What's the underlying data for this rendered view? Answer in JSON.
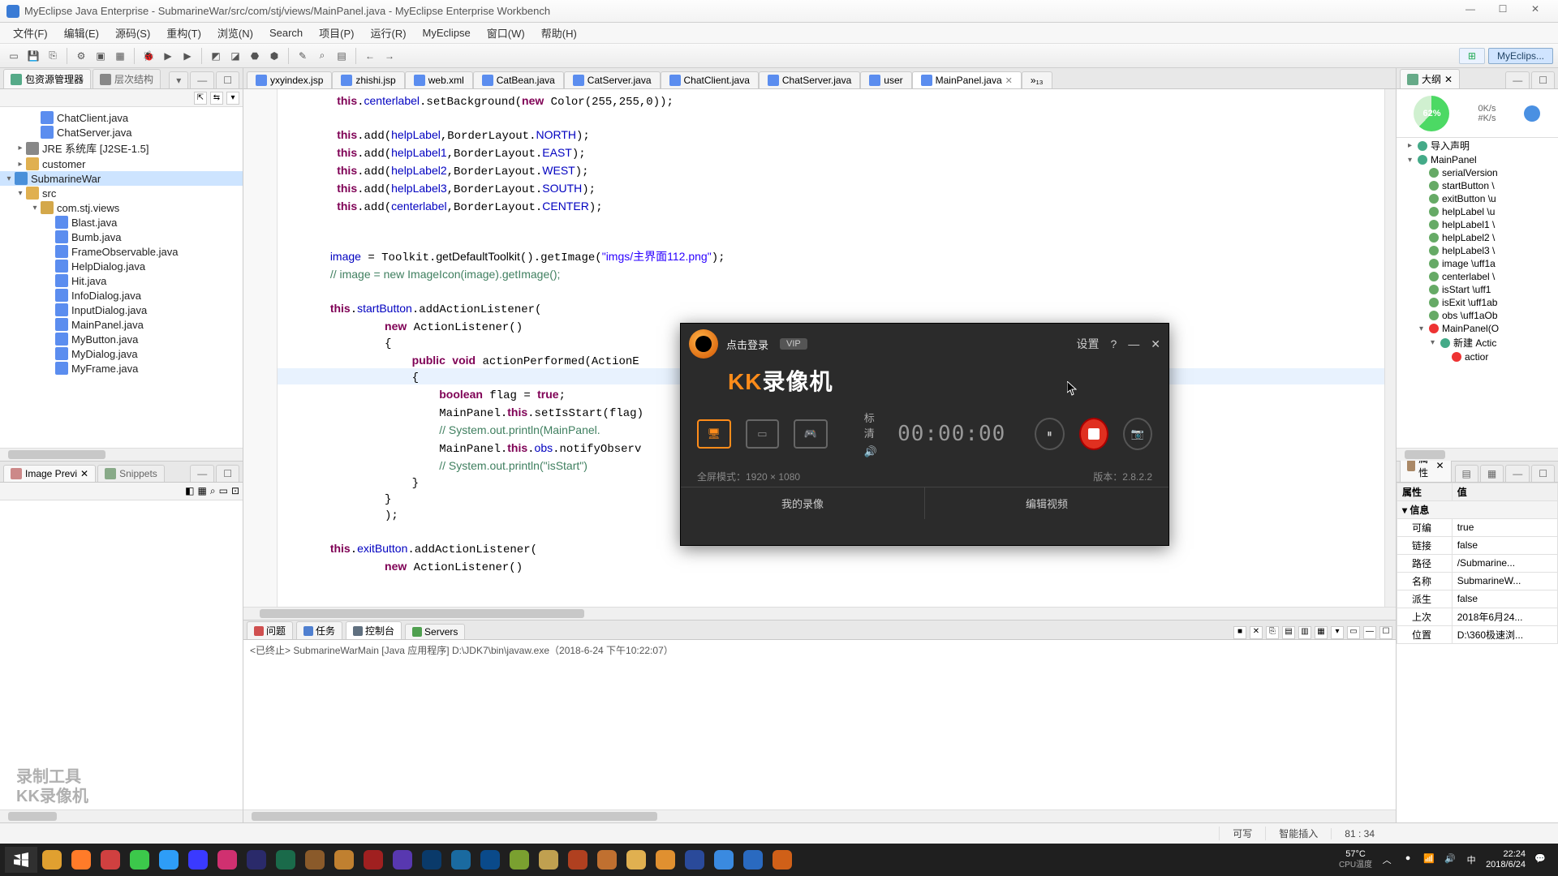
{
  "title": "MyEclipse Java Enterprise  -  SubmarineWar/src/com/stj/views/MainPanel.java  -  MyEclipse Enterprise Workbench",
  "menu": [
    "文件(F)",
    "编辑(E)",
    "源码(S)",
    "重构(T)",
    "浏览(N)",
    "Search",
    "项目(P)",
    "运行(R)",
    "MyEclipse",
    "窗口(W)",
    "帮助(H)"
  ],
  "perspective_active": "MyEclips...",
  "left": {
    "tabs": [
      "包资源管理器",
      "层次结构"
    ],
    "tree": [
      {
        "d": 2,
        "icon": "java",
        "label": "ChatClient.java"
      },
      {
        "d": 2,
        "icon": "java",
        "label": "ChatServer.java"
      },
      {
        "d": 1,
        "icon": "lib",
        "label": "JRE 系统库 [J2SE-1.5]",
        "arrow": "▸"
      },
      {
        "d": 1,
        "icon": "fold",
        "label": "customer",
        "arrow": "▸"
      },
      {
        "d": 0,
        "icon": "proj",
        "label": "SubmarineWar",
        "arrow": "▾",
        "sel": true
      },
      {
        "d": 1,
        "icon": "fold",
        "label": "src",
        "arrow": "▾"
      },
      {
        "d": 2,
        "icon": "pkg",
        "label": "com.stj.views",
        "arrow": "▾"
      },
      {
        "d": 3,
        "icon": "java",
        "label": "Blast.java"
      },
      {
        "d": 3,
        "icon": "java",
        "label": "Bumb.java"
      },
      {
        "d": 3,
        "icon": "java",
        "label": "FrameObservable.java"
      },
      {
        "d": 3,
        "icon": "java",
        "label": "HelpDialog.java"
      },
      {
        "d": 3,
        "icon": "java",
        "label": "Hit.java"
      },
      {
        "d": 3,
        "icon": "java",
        "label": "InfoDialog.java"
      },
      {
        "d": 3,
        "icon": "java",
        "label": "InputDialog.java"
      },
      {
        "d": 3,
        "icon": "java",
        "label": "MainPanel.java"
      },
      {
        "d": 3,
        "icon": "java",
        "label": "MyButton.java"
      },
      {
        "d": 3,
        "icon": "java",
        "label": "MyDialog.java"
      },
      {
        "d": 3,
        "icon": "java",
        "label": "MyFrame.java"
      }
    ],
    "bottom_tabs": [
      "Image Previ",
      "Snippets"
    ],
    "watermark_l1": "录制工具",
    "watermark_l2": "KK录像机"
  },
  "editor": {
    "tabs": [
      {
        "label": "yxyindex.jsp"
      },
      {
        "label": "zhishi.jsp"
      },
      {
        "label": "web.xml"
      },
      {
        "label": "CatBean.java"
      },
      {
        "label": "CatServer.java"
      },
      {
        "label": "ChatClient.java"
      },
      {
        "label": "ChatServer.java"
      },
      {
        "label": "user"
      },
      {
        "label": "MainPanel.java",
        "active": true
      }
    ],
    "code_html": "        <span class='kw'>this</span>.<span class='fld'>centerlabel</span>.setBackground(<span class='kw'>new</span> Color(255,255,0));\n\n        <span class='kw'>this</span>.add(<span class='fld'>helpLabel</span>,BorderLayout.<span class='fld'>NORTH</span>);\n        <span class='kw'>this</span>.add(<span class='fld'>helpLabel1</span>,BorderLayout.<span class='fld'>EAST</span>);\n        <span class='kw'>this</span>.add(<span class='fld'>helpLabel2</span>,BorderLayout.<span class='fld'>WEST</span>);\n        <span class='kw'>this</span>.add(<span class='fld'>helpLabel3</span>,BorderLayout.<span class='fld'>SOUTH</span>);\n        <span class='kw'>this</span>.add(<span class='fld'>centerlabel</span>,BorderLayout.<span class='fld'>CENTER</span>);\n\n\n       <span class='fld'>image</span> = Toolkit.<span class='mth'>getDefaultToolkit</span>().getImage(<span class='str'>\"imgs/主界面112.png\"</span>);\n       <span class='com'>// image = new ImageIcon(image).getImage();</span>\n\n       <span class='kw'>this</span>.<span class='fld'>startButton</span>.addActionListener(\n               <span class='kw'>new</span> ActionListener()\n               {\n                   <span class='kw'>public</span> <span class='kw'>void</span> actionPerformed(ActionE\n                   {\n                       <span class='kw'>boolean</span> flag = <span class='kw'>true</span>;\n                       MainPanel.<span class='kw'>this</span>.setIsStart(flag)\n                       <span class='com'>// System.out.println(MainPanel.</span>\n                       MainPanel.<span class='kw'>this</span>.<span class='fld'>obs</span>.notifyObserv\n                       <span class='com'>// System.out.println(\"isStart\")</span>\n                   }\n               }\n               );\n\n       <span class='kw'>this</span>.<span class='fld'>exitButton</span>.addActionListener(\n               <span class='kw'>new</span> ActionListener()"
  },
  "bottom": {
    "tabs": [
      "问题",
      "任务",
      "控制台",
      "Servers"
    ],
    "active": 2,
    "line": "<已终止> SubmarineWarMain [Java 应用程序] D:\\JDK7\\bin\\javaw.exe（2018-6-24 下午10:22:07）"
  },
  "right": {
    "outline_tab": "大纲",
    "net_pct": "62%",
    "net_up": "0K/s",
    "net_dn": "#K/s",
    "outline": [
      {
        "d": 1,
        "i": "c",
        "t": "导入声明",
        "arrow": "▸"
      },
      {
        "d": 1,
        "i": "c",
        "t": "MainPanel",
        "arrow": "▾"
      },
      {
        "d": 2,
        "i": "f",
        "t": "serialVersion"
      },
      {
        "d": 2,
        "i": "f",
        "t": "startButton \\"
      },
      {
        "d": 2,
        "i": "f",
        "t": "exitButton \\u"
      },
      {
        "d": 2,
        "i": "f",
        "t": "helpLabel \\u"
      },
      {
        "d": 2,
        "i": "f",
        "t": "helpLabel1 \\"
      },
      {
        "d": 2,
        "i": "f",
        "t": "helpLabel2 \\"
      },
      {
        "d": 2,
        "i": "f",
        "t": "helpLabel3 \\"
      },
      {
        "d": 2,
        "i": "f",
        "t": "image \\uff1a"
      },
      {
        "d": 2,
        "i": "f",
        "t": "centerlabel \\"
      },
      {
        "d": 2,
        "i": "f",
        "t": "isStart \\uff1"
      },
      {
        "d": 2,
        "i": "f",
        "t": "isExit \\uff1ab"
      },
      {
        "d": 2,
        "i": "f",
        "t": "obs \\uff1aOb"
      },
      {
        "d": 2,
        "i": "m",
        "t": "MainPanel(O",
        "arrow": "▾"
      },
      {
        "d": 3,
        "i": "c",
        "t": "新建 Actic",
        "arrow": "▾"
      },
      {
        "d": 4,
        "i": "m",
        "t": "actior"
      }
    ],
    "props_tab": "属性",
    "props_header": [
      "属性",
      "值"
    ],
    "props_group": "信息",
    "props": [
      [
        "可编",
        "true"
      ],
      [
        "链接",
        "false"
      ],
      [
        "路径",
        "/Submarine..."
      ],
      [
        "名称",
        "SubmarineW..."
      ],
      [
        "派生",
        "false"
      ],
      [
        "上次",
        "2018年6月24..."
      ],
      [
        "位置",
        "D:\\360极速浏..."
      ]
    ]
  },
  "status": {
    "writable": "可写",
    "insert": "智能插入",
    "pos": "81 : 34"
  },
  "kk": {
    "login": "点击登录",
    "vip": "VIP",
    "settings": "设置",
    "brand_prefix": "KK",
    "brand_rest": "录像机",
    "quality": "标清",
    "time": "00:00:00",
    "mode_info": "全屏模式：1920 × 1080",
    "version": "版本：2.8.2.2",
    "my_rec": "我的录像",
    "edit_vid": "编辑视频"
  },
  "tray": {
    "temp": "57°C",
    "temp_label": "CPU温度",
    "time": "22:24",
    "date": "2018/6/24"
  },
  "taskbar_colors": [
    "#e0a030",
    "#ff7b29",
    "#d04040",
    "#3cc84b",
    "#2e9df7",
    "#3a3aff",
    "#d03070",
    "#2a2a6a",
    "#1a6a4a",
    "#8a5a2a",
    "#c08030",
    "#a02020",
    "#5838b0",
    "#0a3a6a",
    "#1a6aa0",
    "#0a4a8a",
    "#7aa030",
    "#c0a050",
    "#b04020",
    "#c07030",
    "#e0b050",
    "#e09030",
    "#2a4a9a",
    "#3a8ae0",
    "#2a6ac0",
    "#d06018"
  ]
}
